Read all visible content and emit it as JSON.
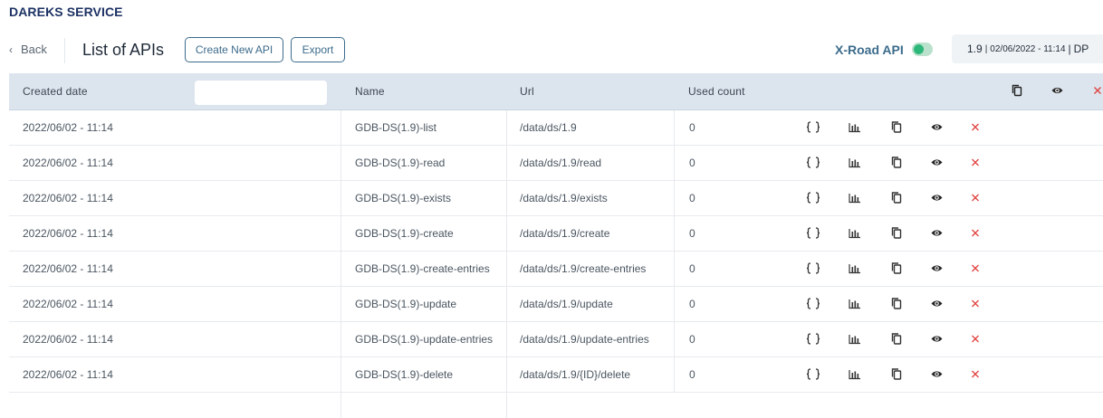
{
  "app": {
    "service_name": "DAREKS SERVICE"
  },
  "toolbar": {
    "back_label": "Back",
    "page_title": "List of APIs",
    "create_label": "Create New API",
    "export_label": "Export",
    "xroad_label": "X-Road API",
    "xroad_enabled": true,
    "version": "1.9",
    "version_sep1": "|",
    "version_date": "02/06/2022 - 11:14",
    "version_sep2": "|",
    "version_user": "DP"
  },
  "table": {
    "columns": {
      "created": "Created date",
      "name": "Name",
      "url": "Url",
      "used": "Used count"
    },
    "filter_value": "",
    "rows": [
      {
        "created": "2022/06/02 - 11:14",
        "name": "GDB-DS(1.9)-list",
        "url": "/data/ds/1.9",
        "used": "0"
      },
      {
        "created": "2022/06/02 - 11:14",
        "name": "GDB-DS(1.9)-read",
        "url": "/data/ds/1.9/read",
        "used": "0"
      },
      {
        "created": "2022/06/02 - 11:14",
        "name": "GDB-DS(1.9)-exists",
        "url": "/data/ds/1.9/exists",
        "used": "0"
      },
      {
        "created": "2022/06/02 - 11:14",
        "name": "GDB-DS(1.9)-create",
        "url": "/data/ds/1.9/create",
        "used": "0"
      },
      {
        "created": "2022/06/02 - 11:14",
        "name": "GDB-DS(1.9)-create-entries",
        "url": "/data/ds/1.9/create-entries",
        "used": "0"
      },
      {
        "created": "2022/06/02 - 11:14",
        "name": "GDB-DS(1.9)-update",
        "url": "/data/ds/1.9/update",
        "used": "0"
      },
      {
        "created": "2022/06/02 - 11:14",
        "name": "GDB-DS(1.9)-update-entries",
        "url": "/data/ds/1.9/update-entries",
        "used": "0"
      },
      {
        "created": "2022/06/02 - 11:14",
        "name": "GDB-DS(1.9)-delete",
        "url": "/data/ds/1.9/{ID}/delete",
        "used": "0"
      }
    ]
  },
  "icons": {
    "json": "braces-icon",
    "stats": "bar-chart-icon",
    "copy": "copy-icon",
    "view": "eye-icon",
    "delete": "close-icon",
    "header_copy": "copy-icon",
    "header_view": "eye-icon",
    "header_delete": "close-icon"
  },
  "colors": {
    "brand": "#1d3264",
    "accent": "#3c6c8c",
    "header_bg": "#dce5ee",
    "toggle_on": "#2db87a",
    "danger": "#e0423f"
  }
}
